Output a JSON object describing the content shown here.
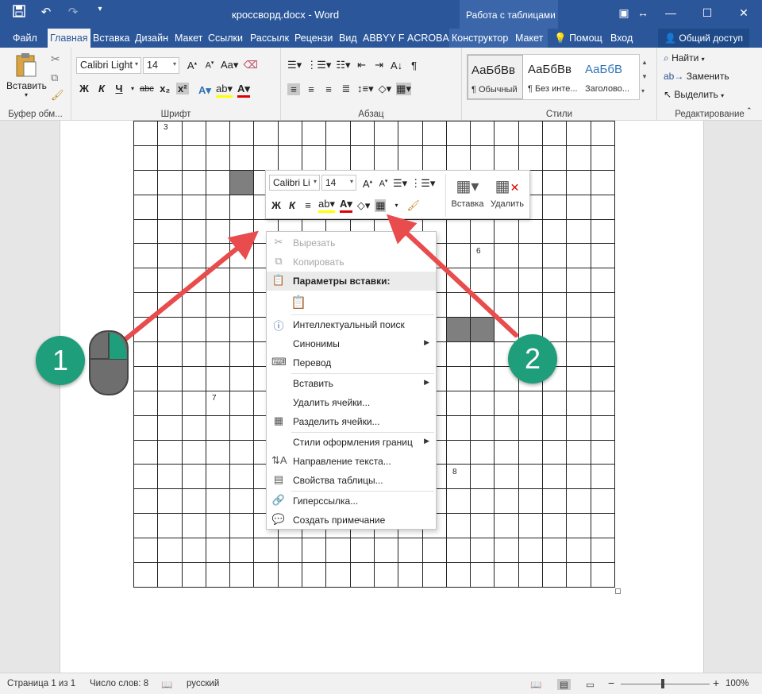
{
  "titlebar": {
    "doc_title": "кроссворд.docx - Word",
    "context_tools": "Работа с таблицами",
    "qat": [
      "save-icon",
      "undo-icon",
      "redo-icon",
      "customize-icon"
    ]
  },
  "tabs": {
    "file": "Файл",
    "items": [
      "Главная",
      "Вставка",
      "Дизайн",
      "Макет",
      "Ссылки",
      "Рассылк",
      "Рецензи",
      "Вид",
      "ABBYY Fi",
      "ACROBA",
      "Конструктор",
      "Макет"
    ],
    "help": "Помощ",
    "signin": "Вход",
    "share": "Общий доступ"
  },
  "ribbon": {
    "clipboard": {
      "paste": "Вставить",
      "label": "Буфер обм..."
    },
    "font": {
      "name": "Calibri Light",
      "size": "14",
      "label": "Шрифт",
      "bold": "Ж",
      "italic": "К",
      "underline": "Ч",
      "strike": "abc",
      "sub": "x₂",
      "sup": "x²"
    },
    "paragraph": {
      "label": "Абзац"
    },
    "styles": {
      "label": "Стили",
      "items": [
        {
          "sample": "АаБбВв",
          "name": "¶ Обычный"
        },
        {
          "sample": "АаБбВв",
          "name": "¶ Без инте..."
        },
        {
          "sample": "АаБбВ",
          "name": "Заголово..."
        }
      ]
    },
    "editing": {
      "find": "Найти",
      "replace": "Заменить",
      "select": "Выделить",
      "label": "Редактирование"
    }
  },
  "crossword": {
    "numbers": [
      "3",
      "6",
      "7",
      "8"
    ]
  },
  "minitoolbar": {
    "font": "Calibri Li",
    "size": "14",
    "bold": "Ж",
    "italic": "К",
    "insert": "Вставка",
    "delete": "Удалить"
  },
  "context_menu": {
    "cut": "Вырезать",
    "copy": "Копировать",
    "paste_options": "Параметры вставки:",
    "smart_lookup": "Интеллектуальный поиск",
    "synonyms": "Синонимы",
    "translate": "Перевод",
    "insert": "Вставить",
    "delete_cells": "Удалить ячейки...",
    "split_cells": "Разделить ячейки...",
    "border_styles": "Стили оформления границ",
    "text_direction": "Направление текста...",
    "table_properties": "Свойства таблицы...",
    "hyperlink": "Гиперссылка...",
    "new_comment": "Создать примечание"
  },
  "annotations": {
    "badge1": "1",
    "badge2": "2",
    "arrow_color": "#e84c4c",
    "badge_color": "#1e9e7a"
  },
  "statusbar": {
    "page": "Страница 1 из 1",
    "words": "Число слов: 8",
    "language": "русский",
    "zoom": "100%"
  },
  "colors": {
    "word_blue": "#2b579a"
  }
}
